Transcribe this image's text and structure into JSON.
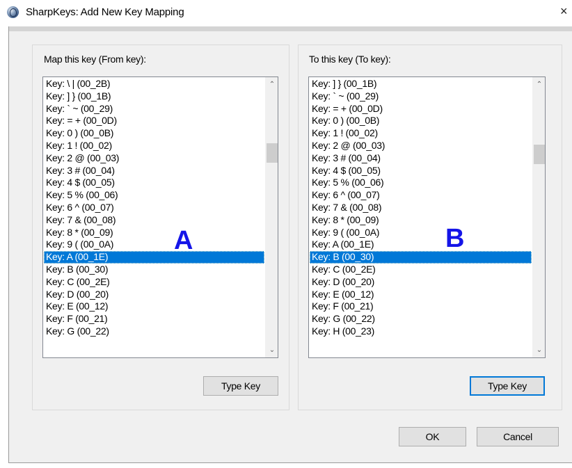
{
  "window": {
    "title": "SharpKeys: Add New Key Mapping",
    "close_glyph": "×"
  },
  "from_panel": {
    "label": "Map this key (From key):",
    "items": [
      "Key: \\ | (00_2B)",
      "Key: ] } (00_1B)",
      "Key: ` ~ (00_29)",
      "Key: = + (00_0D)",
      "Key: 0 ) (00_0B)",
      "Key: 1 ! (00_02)",
      "Key: 2 @ (00_03)",
      "Key: 3 # (00_04)",
      "Key: 4 $ (00_05)",
      "Key: 5 % (00_06)",
      "Key: 6 ^ (00_07)",
      "Key: 7 & (00_08)",
      "Key: 8 * (00_09)",
      "Key: 9 ( (00_0A)",
      "Key: A (00_1E)",
      "Key: B (00_30)",
      "Key: C (00_2E)",
      "Key: D (00_20)",
      "Key: E (00_12)",
      "Key: F (00_21)",
      "Key: G (00_22)"
    ],
    "selected_index": 14,
    "annotation": "A",
    "type_key_label": "Type Key"
  },
  "to_panel": {
    "label": "To this key (To key):",
    "items": [
      "Key: ] } (00_1B)",
      "Key: ` ~ (00_29)",
      "Key: = + (00_0D)",
      "Key: 0 ) (00_0B)",
      "Key: 1 ! (00_02)",
      "Key: 2 @ (00_03)",
      "Key: 3 # (00_04)",
      "Key: 4 $ (00_05)",
      "Key: 5 % (00_06)",
      "Key: 6 ^ (00_07)",
      "Key: 7 & (00_08)",
      "Key: 8 * (00_09)",
      "Key: 9 ( (00_0A)",
      "Key: A (00_1E)",
      "Key: B (00_30)",
      "Key: C (00_2E)",
      "Key: D (00_20)",
      "Key: E (00_12)",
      "Key: F (00_21)",
      "Key: G (00_22)",
      "Key: H (00_23)"
    ],
    "selected_index": 14,
    "annotation": "B",
    "type_key_label": "Type Key"
  },
  "footer": {
    "ok_label": "OK",
    "cancel_label": "Cancel"
  },
  "icons": {
    "scroll_up": "⌃",
    "scroll_down": "⌄"
  },
  "colors": {
    "selection": "#0078d7",
    "annotation": "#1515e8",
    "focus_border": "#0078d7"
  }
}
